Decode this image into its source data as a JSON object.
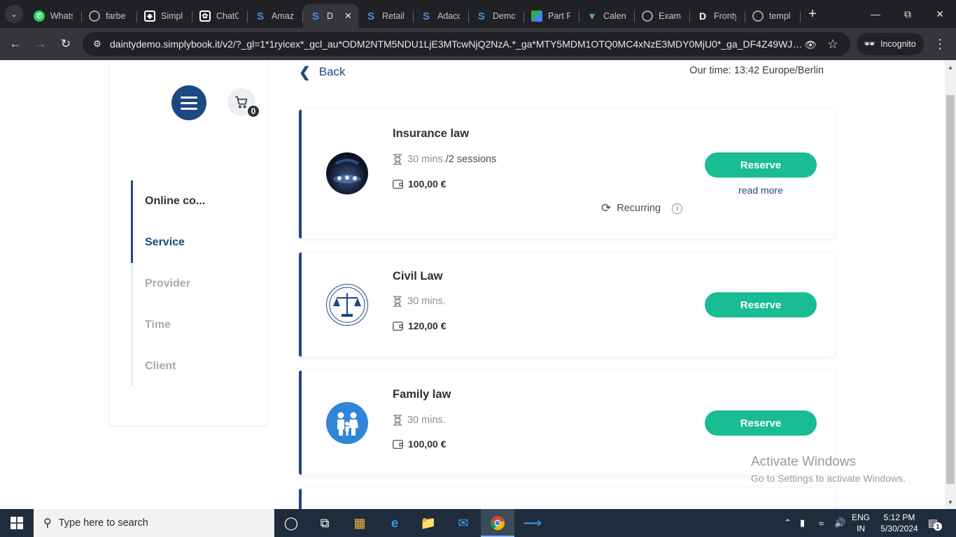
{
  "browser": {
    "tabs": [
      {
        "label": "Whats",
        "icon": "whatsapp-icon",
        "color": "#25d366"
      },
      {
        "label": "farbe",
        "icon": "globe-icon",
        "color": "#9aa0a6"
      },
      {
        "label": "Simpl",
        "icon": "simplybook-icon",
        "color": "#ffffff"
      },
      {
        "label": "ChatG",
        "icon": "chatgpt-icon",
        "color": "#ffffff"
      },
      {
        "label": "Amaz",
        "icon": "simplybook-s-icon",
        "color": "#4a90d9"
      },
      {
        "label": "D",
        "icon": "simplybook-s-icon",
        "color": "#4a90d9"
      },
      {
        "label": "Retail",
        "icon": "simplybook-s-icon",
        "color": "#4a90d9"
      },
      {
        "label": "Adaco",
        "icon": "simplybook-s-icon",
        "color": "#4a90d9"
      },
      {
        "label": "Demo",
        "icon": "simplybook-s-icon",
        "color": "#4a90d9"
      },
      {
        "label": "Part P",
        "icon": "partp-icon",
        "color": "#34a853"
      },
      {
        "label": "Calen",
        "icon": "vue-icon",
        "color": "#42b883"
      },
      {
        "label": "Exam",
        "icon": "globe-icon",
        "color": "#9aa0a6"
      },
      {
        "label": "Fronty",
        "icon": "fronty-icon",
        "color": "#ffffff"
      },
      {
        "label": "templ",
        "icon": "globe-icon",
        "color": "#9aa0a6"
      }
    ],
    "url": "daintydemo.simplybook.it/v2/?_gl=1*1ryicex*_gcl_au*ODM2NTM5NDU1LjE3MTcwNjQ2NzA.*_ga*MTY5MDM1OTQ0MC4xNzE3MDY0MjU0*_ga_DF4Z49WJND*...",
    "incognito_label": "Incognito"
  },
  "sidebar": {
    "cart_count": "0",
    "steps": [
      {
        "label": "Online co...",
        "state": "done"
      },
      {
        "label": "Service",
        "state": "current"
      },
      {
        "label": "Provider",
        "state": "pending"
      },
      {
        "label": "Time",
        "state": "pending"
      },
      {
        "label": "Client",
        "state": "pending"
      }
    ]
  },
  "header": {
    "back_label": "Back",
    "our_time": "Our time: 13:42 Europe/Berlin"
  },
  "services": [
    {
      "name": "Insurance law",
      "duration": "30 mins.",
      "sessions": "/2 sessions",
      "price": "100,00 €",
      "reserve_label": "Reserve",
      "read_more": "read more",
      "recurring_label": "Recurring",
      "image": "insurance-image"
    },
    {
      "name": "Civil Law",
      "duration": "30 mins.",
      "price": "120,00 €",
      "reserve_label": "Reserve",
      "image": "scales-of-justice-image"
    },
    {
      "name": "Family law",
      "duration": "30 mins.",
      "price": "100,00 €",
      "reserve_label": "Reserve",
      "image": "family-image"
    }
  ],
  "watermark": {
    "line1": "Activate Windows",
    "line2": "Go to Settings to activate Windows."
  },
  "taskbar": {
    "search_placeholder": "Type here to search",
    "lang_line1": "ENG",
    "lang_line2": "IN",
    "time": "5:12 PM",
    "date": "5/30/2024",
    "notification_count": "1"
  },
  "colors": {
    "brand": "#1c4883",
    "accent": "#1abc94"
  }
}
